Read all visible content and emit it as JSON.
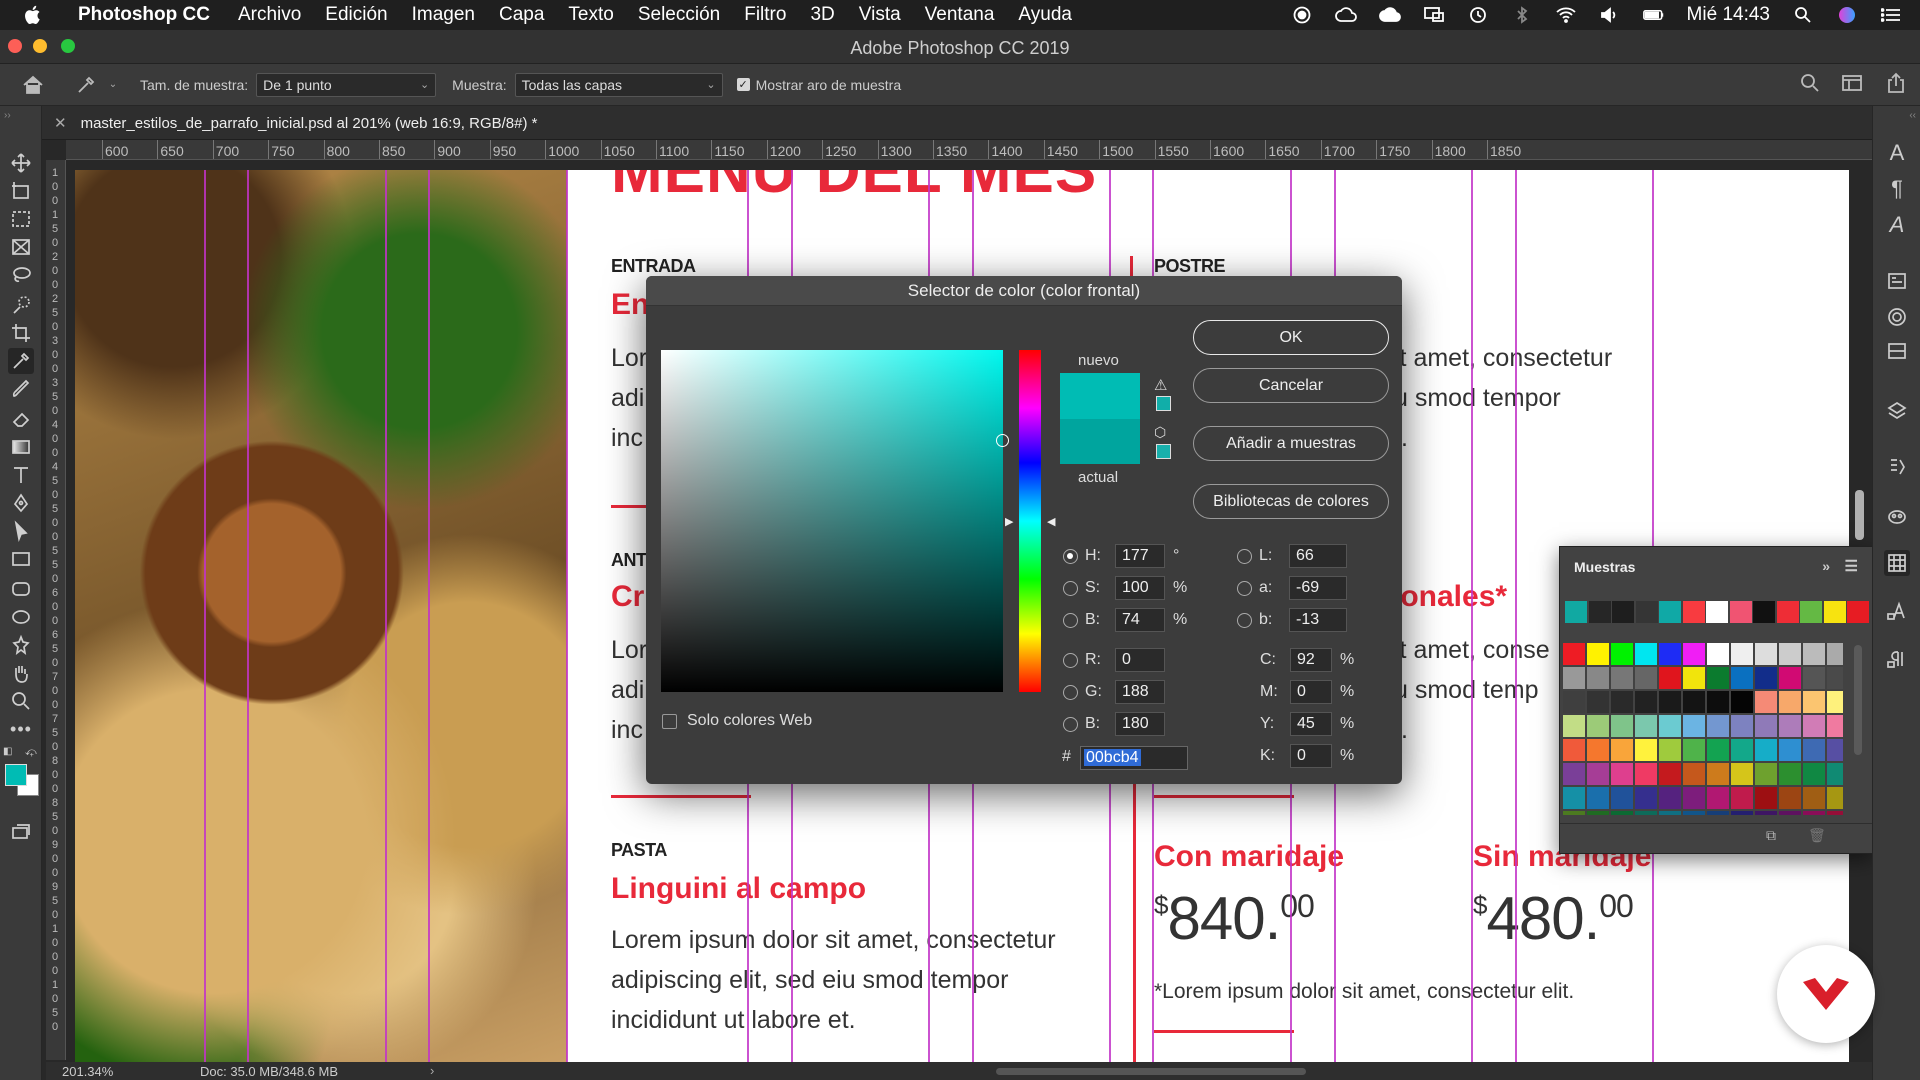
{
  "menubar": {
    "app": "Photoshop CC",
    "items": [
      "Archivo",
      "Edición",
      "Imagen",
      "Capa",
      "Texto",
      "Selección",
      "Filtro",
      "3D",
      "Vista",
      "Ventana",
      "Ayuda"
    ],
    "clock": "Mié 14:43"
  },
  "window": {
    "title": "Adobe Photoshop CC 2019"
  },
  "options": {
    "sample_size_label": "Tam. de muestra:",
    "sample_size_value": "De 1 punto",
    "sample_label": "Muestra:",
    "sample_value": "Todas las capas",
    "show_ring_label": "Mostrar aro de muestra",
    "show_ring_checked": true
  },
  "document": {
    "tab_title": "master_estilos_de_parrafo_inicial.psd al 201% (web 16:9, RGB/8#) *",
    "zoom": "201.34%",
    "doc_info": "Doc: 35.0 MB/348.6 MB"
  },
  "ruler": {
    "labels": [
      "600",
      "650",
      "700",
      "750",
      "800",
      "850",
      "900",
      "950",
      "1000",
      "1050",
      "1100",
      "1150",
      "1200",
      "1250",
      "1300",
      "1350",
      "1400",
      "1450",
      "1500",
      "1550",
      "1600",
      "1650",
      "1700",
      "1750",
      "1800",
      "1850"
    ],
    "left_labels": [
      "1",
      "0",
      "0",
      "1",
      "5",
      "0",
      "2",
      "0",
      "0",
      "2",
      "5",
      "0",
      "3",
      "0",
      "0",
      "3",
      "5",
      "0",
      "4",
      "0",
      "0",
      "4",
      "5",
      "0",
      "5",
      "0",
      "0",
      "5",
      "5",
      "0",
      "6",
      "0",
      "0",
      "6",
      "5",
      "0",
      "7",
      "0",
      "0",
      "7",
      "5",
      "0",
      "8",
      "0",
      "0",
      "8",
      "5",
      "0",
      "9",
      "0",
      "0",
      "9",
      "5",
      "0",
      "1",
      "0",
      "0",
      "0",
      "1",
      "0",
      "5",
      "0"
    ]
  },
  "page": {
    "heading": "MENÚ DEL MES",
    "entrada_label": "ENTRADA",
    "entrada_title": "En",
    "entrada_lines": [
      "Lor",
      "adi",
      "inc"
    ],
    "postre_label": "POSTRE",
    "postre_lines": [
      "it amet, consectetur",
      "u smod tempor",
      "t."
    ],
    "ant_label": "ANT",
    "ant_title": "Cr",
    "ant_right_title": "ionales*",
    "ant_lines": [
      "Lor",
      "adi",
      "inc"
    ],
    "ant_right_lines": [
      "it amet, conse",
      "u smod temp",
      "t."
    ],
    "pasta_label": "PASTA",
    "pasta_title": "Linguini al campo",
    "pasta_lines": [
      "Lorem ipsum dolor sit amet, consectetur",
      "adipiscing elit, sed eiu smod tempor",
      "incididunt ut labore et."
    ],
    "con_label": "Con maridaje",
    "sin_label": "Sin maridaje",
    "con_currency": "$",
    "con_price": "840.",
    "con_cents": "00",
    "sin_currency": "$",
    "sin_price": "480.",
    "sin_cents": "00",
    "footnote": "*Lorem ipsum dolor sit amet, consectetur elit."
  },
  "picker": {
    "title": "Selector de color (color frontal)",
    "new_label": "nuevo",
    "current_label": "actual",
    "buttons": {
      "ok": "OK",
      "cancel": "Cancelar",
      "add": "Añadir a muestras",
      "libs": "Bibliotecas de colores"
    },
    "web_only": "Solo colores Web",
    "hsb": {
      "H": "177",
      "S": "100",
      "B": "74"
    },
    "rgb": {
      "R": "0",
      "G": "188",
      "B": "180"
    },
    "lab": {
      "L": "66",
      "a": "-69",
      "b": "-13"
    },
    "cmyk": {
      "C": "92",
      "M": "0",
      "Y": "45",
      "K": "0"
    },
    "hex": "00bcb4",
    "labels": {
      "H": "H:",
      "S": "S:",
      "B": "B:",
      "R": "R:",
      "G": "G:",
      "B2": "B:",
      "L": "L:",
      "a": "a:",
      "b": "b:",
      "C": "C:",
      "M": "M:",
      "Y": "Y:",
      "K": "K:",
      "hash": "#",
      "deg": "°",
      "pct": "%"
    },
    "selected_mode": "H",
    "colors": {
      "new": "#00bcb4",
      "current": "#00a59e",
      "gamut_swatch": "#11aea9",
      "web_swatch": "#18b0ac"
    }
  },
  "swatches": {
    "title": "Muestras",
    "recent": [
      "#11a9a2",
      "#262626",
      "#1e1e1e",
      "#353535",
      "#10a9a6",
      "#f83b40",
      "#ffffff",
      "#f05472",
      "#111111",
      "#ee2d36",
      "#64b944",
      "#f7e310",
      "#e71c23"
    ],
    "grid": [
      "#ee1c24",
      "#fff200",
      "#00f200",
      "#00e6f0",
      "#1e2cf5",
      "#f01ef5",
      "#ffffff",
      "#efefef",
      "#dddddd",
      "#cccccc",
      "#bbbbbb",
      "#aaaaaa",
      "#999999",
      "#888888",
      "#777777",
      "#666666",
      "#e0151d",
      "#f1e40c",
      "#0b7b2e",
      "#0a70c0",
      "#122d8a",
      "#d10a73",
      "#555555",
      "#4a4a4a",
      "#3f3f3f",
      "#333333",
      "#2a2a2a",
      "#222222",
      "#1a1a1a",
      "#141414",
      "#0d0d0d",
      "#050505",
      "#f58a76",
      "#f7a86a",
      "#fbc570",
      "#fef17c",
      "#c2dd86",
      "#9ccb78",
      "#7fc48a",
      "#7bc8ad",
      "#6bcbd1",
      "#6bb4e3",
      "#7397d0",
      "#7d82c0",
      "#8f7ab8",
      "#ad7cba",
      "#d17cb6",
      "#f07aa0",
      "#f05a3a",
      "#f5772d",
      "#f9a53a",
      "#fff23d",
      "#9fcb3d",
      "#4fb34a",
      "#13a351",
      "#13a88a",
      "#16adc8",
      "#2e8fd1",
      "#3e6ab3",
      "#574fa3",
      "#7a3f98",
      "#a63d96",
      "#de3f8e",
      "#ef3a64",
      "#c41a1e",
      "#c5581c",
      "#cd7b1c",
      "#d5c51a",
      "#6ea12e",
      "#2c8f2f",
      "#108843",
      "#108a73",
      "#1590a6",
      "#1a6fac",
      "#20529a",
      "#352f8e",
      "#55227f",
      "#7d1d7c",
      "#b11872",
      "#c01b4c",
      "#9d0f12",
      "#9c4513",
      "#a05e14",
      "#a69712",
      "#4c7a20",
      "#1f6b22",
      "#0c6a33",
      "#0d6b5a",
      "#0f6f82",
      "#11558a",
      "#163e78",
      "#241f70",
      "#3e1564",
      "#5e1160",
      "#8a0d58",
      "#960e38"
    ]
  },
  "colors": {
    "accent_red": "#e8293a",
    "guide": "#c234c8",
    "fg": "#00bcb4",
    "bg": "#ffffff",
    "logo_red": "#d91f2b"
  }
}
